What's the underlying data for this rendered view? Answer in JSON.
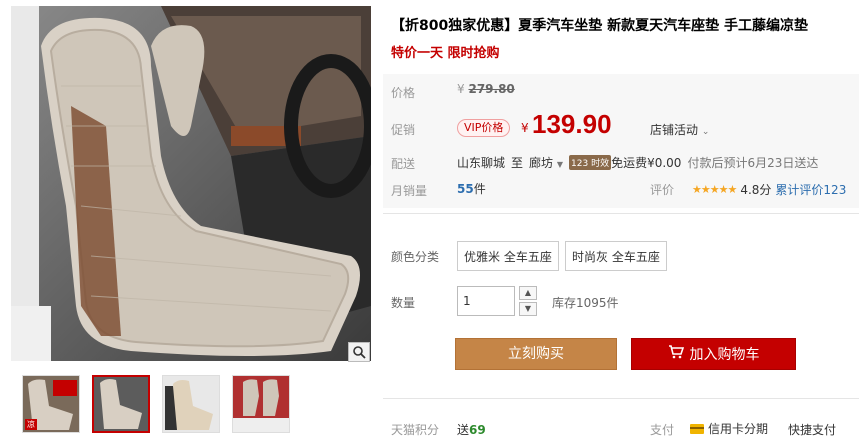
{
  "product": {
    "title": "【折800独家优惠】夏季汽车坐垫 新款夏天汽车座垫 手工藤编凉垫",
    "subtitle": "特价一天 限时抢购"
  },
  "price_section": {
    "price_label": "价格",
    "original_price_prefix": "¥",
    "original_price": "279.80",
    "promo_label": "促销",
    "vip_tag": "VIP价格",
    "promo_price_prefix": "¥",
    "promo_price": "139.90",
    "shop_activity": "店铺活动"
  },
  "shipping": {
    "label": "配送",
    "from": "山东聊城",
    "to_word": "至",
    "to": "廊坊",
    "speed_tag": "123 时效",
    "fee": "免运费¥0.00",
    "eta": "付款后预计6月23日送达"
  },
  "stats": {
    "sales_label": "月销量",
    "sales_count": "55",
    "sales_unit": "件",
    "rating_label": "评价",
    "stars": "★★★★★",
    "rating_score": "4.8分",
    "review_link": "累计评价123"
  },
  "options": {
    "color_label": "颜色分类",
    "colors": [
      "优雅米 全车五座",
      "时尚灰 全车五座"
    ],
    "qty_label": "数量",
    "qty_value": "1",
    "stock": "库存1095件"
  },
  "actions": {
    "buy_now": "立刻购买",
    "add_to_cart": "加入购物车"
  },
  "footer": {
    "points_label": "天猫积分",
    "points_prefix": "送",
    "points_value": "69",
    "pay_label": "支付",
    "credit_installment": "信用卡分期",
    "quick_pay": "快捷支付"
  },
  "gallery": {
    "thumb_badge": "凉"
  },
  "colors": {
    "accent_red": "#c40000",
    "buy_button": "#c58547",
    "link_blue": "#2d6eaf"
  }
}
